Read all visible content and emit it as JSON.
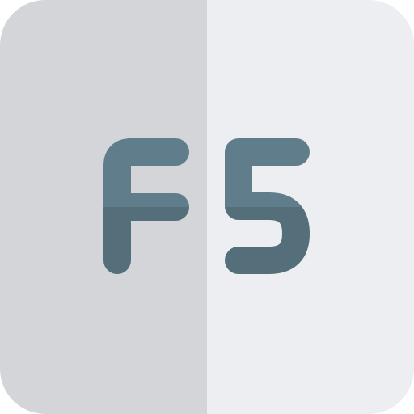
{
  "key": {
    "label": "F5",
    "icon": "f5-key-icon"
  },
  "colors": {
    "key_left": "#D3D5D8",
    "key_right": "#EDEEF1",
    "glyph_top": "#607D8B",
    "glyph_bottom": "#546E7A"
  }
}
